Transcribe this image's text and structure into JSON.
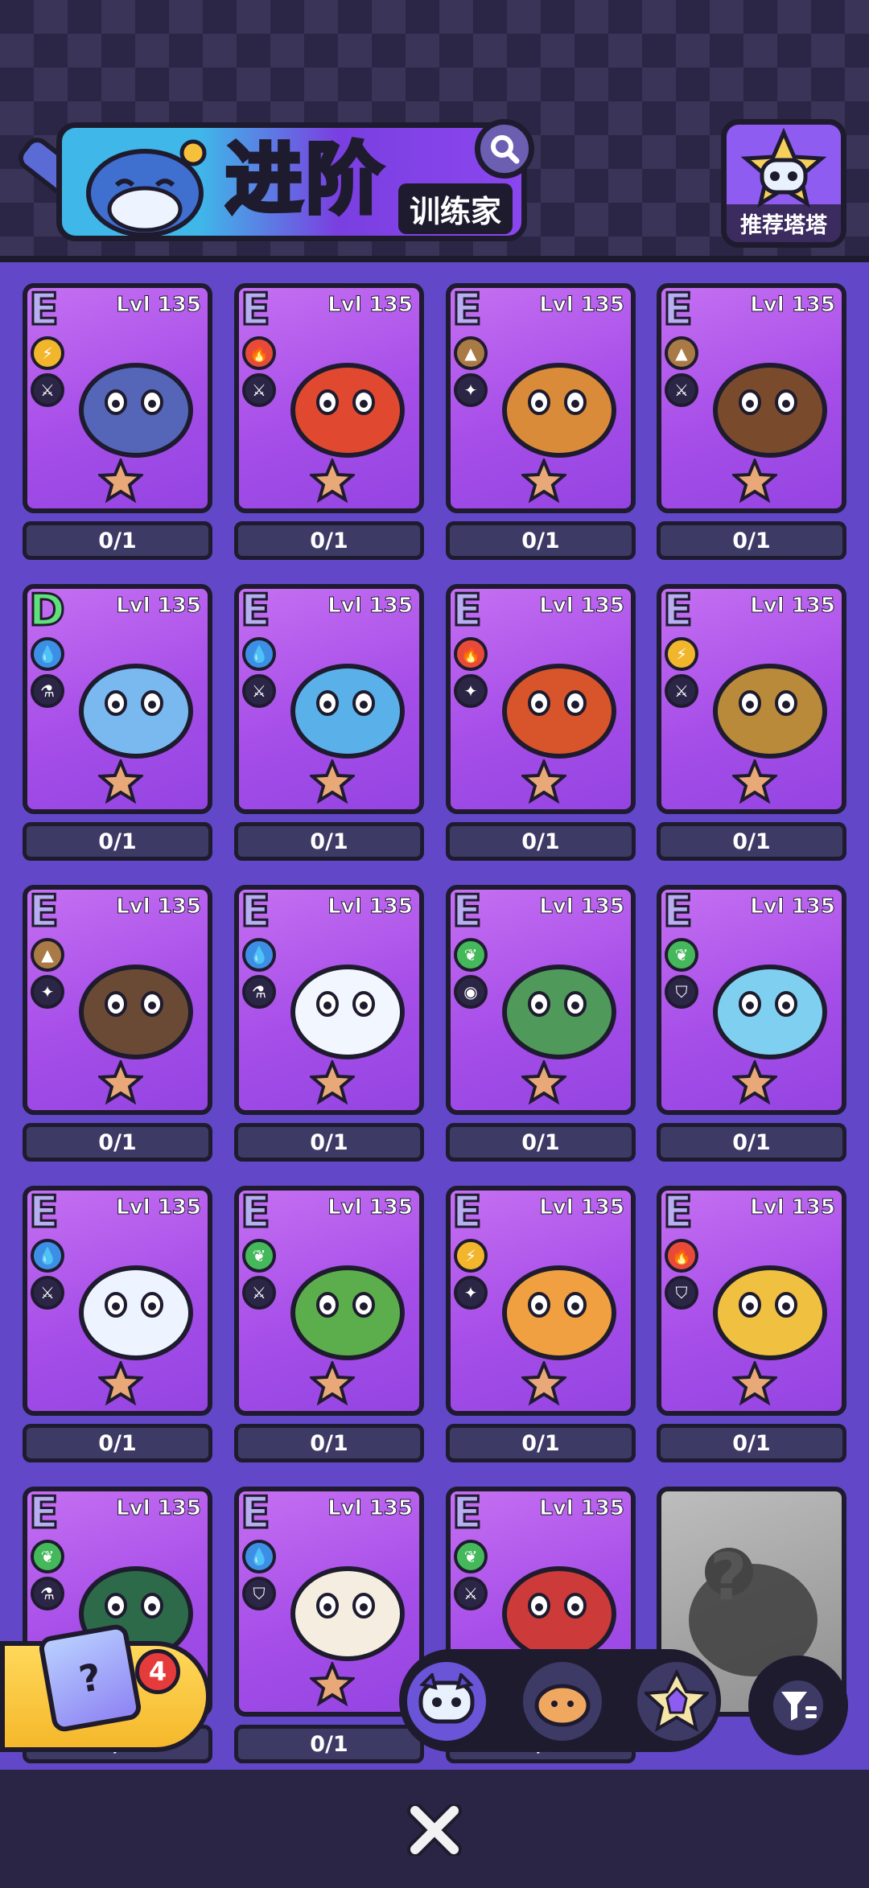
{
  "header": {
    "title": "进阶",
    "subtitle": "训练家",
    "recommend_label": "推荐塔塔"
  },
  "colors": {
    "fire": "#e84a3a",
    "water": "#3d8fe6",
    "electric": "#f2b62c",
    "earth": "#a97a45",
    "grass": "#44b85a"
  },
  "pets": [
    {
      "grade": "E",
      "level": "Lvl 135",
      "element": "electric",
      "role": "sword",
      "count": "0/1"
    },
    {
      "grade": "E",
      "level": "Lvl 135",
      "element": "fire",
      "role": "sword",
      "count": "0/1"
    },
    {
      "grade": "E",
      "level": "Lvl 135",
      "element": "earth",
      "role": "feather",
      "count": "0/1"
    },
    {
      "grade": "E",
      "level": "Lvl 135",
      "element": "earth",
      "role": "sword",
      "count": "0/1"
    },
    {
      "grade": "D",
      "level": "Lvl 135",
      "element": "water",
      "role": "flask",
      "count": "0/1"
    },
    {
      "grade": "E",
      "level": "Lvl 135",
      "element": "water",
      "role": "sword",
      "count": "0/1"
    },
    {
      "grade": "E",
      "level": "Lvl 135",
      "element": "fire",
      "role": "feather",
      "count": "0/1"
    },
    {
      "grade": "E",
      "level": "Lvl 135",
      "element": "electric",
      "role": "sword",
      "count": "0/1"
    },
    {
      "grade": "E",
      "level": "Lvl 135",
      "element": "earth",
      "role": "feather",
      "count": "0/1"
    },
    {
      "grade": "E",
      "level": "Lvl 135",
      "element": "water",
      "role": "flask",
      "count": "0/1"
    },
    {
      "grade": "E",
      "level": "Lvl 135",
      "element": "grass",
      "role": "eye",
      "count": "0/1"
    },
    {
      "grade": "E",
      "level": "Lvl 135",
      "element": "grass",
      "role": "shield",
      "count": "0/1"
    },
    {
      "grade": "E",
      "level": "Lvl 135",
      "element": "water",
      "role": "sword",
      "count": "0/1"
    },
    {
      "grade": "E",
      "level": "Lvl 135",
      "element": "grass",
      "role": "sword",
      "count": "0/1"
    },
    {
      "grade": "E",
      "level": "Lvl 135",
      "element": "electric",
      "role": "feather",
      "count": "0/1"
    },
    {
      "grade": "E",
      "level": "Lvl 135",
      "element": "fire",
      "role": "shield",
      "count": "0/1"
    },
    {
      "grade": "E",
      "level": "Lvl 135",
      "element": "grass",
      "role": "flask",
      "count": "0/1"
    },
    {
      "grade": "E",
      "level": "Lvl 135",
      "element": "water",
      "role": "shield",
      "count": "0/1"
    },
    {
      "grade": "E",
      "level": "Lvl 135",
      "element": "grass",
      "role": "sword",
      "count": "0/1"
    },
    {
      "grade": "",
      "level": "",
      "element": "",
      "role": "",
      "count": "",
      "locked": true,
      "mystery": "?"
    }
  ],
  "gift": {
    "badge": "4",
    "icon": "?"
  },
  "bottom_tabs": [
    "robot-pet-tab",
    "hamster-pet-tab",
    "crystal-pet-tab"
  ],
  "close_icon": "close-icon"
}
